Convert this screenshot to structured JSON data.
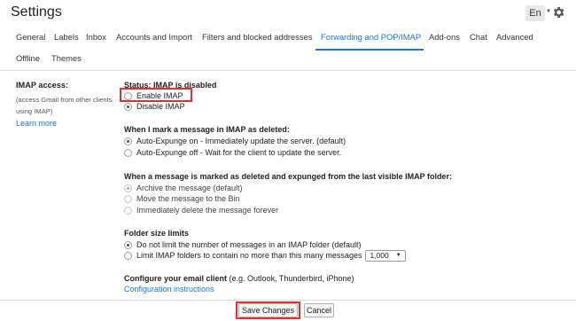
{
  "header": {
    "title": "Settings",
    "language": "En"
  },
  "tabs": [
    {
      "label": "General"
    },
    {
      "label": "Labels"
    },
    {
      "label": "Inbox"
    },
    {
      "label": "Accounts and Import"
    },
    {
      "label": "Filters and blocked addresses"
    },
    {
      "label": "Forwarding and POP/IMAP",
      "active": true
    },
    {
      "label": "Add-ons"
    },
    {
      "label": "Chat"
    },
    {
      "label": "Advanced"
    },
    {
      "label": "Offline"
    },
    {
      "label": "Themes"
    }
  ],
  "imap": {
    "label": "IMAP access:",
    "sub": "(access Gmail from other clients using IMAP)",
    "learn_more": "Learn more",
    "status": "Status: IMAP is disabled",
    "enable": "Enable IMAP",
    "disable": "Disable IMAP",
    "selected": "disable"
  },
  "deleted": {
    "title": "When I mark a message in IMAP as deleted:",
    "options": [
      "Auto-Expunge on - Immediately update the server. (default)",
      "Auto-Expunge off - Wait for the client to update the server."
    ],
    "selected": 0
  },
  "expunged": {
    "title": "When a message is marked as deleted and expunged from the last visible IMAP folder:",
    "options": [
      "Archive the message (default)",
      "Move the message to the Bin",
      "Immediately delete the message forever"
    ],
    "selected": 0
  },
  "folder": {
    "title": "Folder size limits",
    "options": [
      "Do not limit the number of messages in an IMAP folder (default)",
      "Limit IMAP folders to contain no more than this many messages"
    ],
    "selected": 0,
    "limit_value": "1,000"
  },
  "client": {
    "title": "Configure your email client",
    "examples": "(e.g. Outlook, Thunderbird, iPhone)",
    "link": "Configuration instructions"
  },
  "buttons": {
    "save": "Save Changes",
    "cancel": "Cancel"
  },
  "highlight_color": "#e03131",
  "accent_color": "#1a73e8"
}
